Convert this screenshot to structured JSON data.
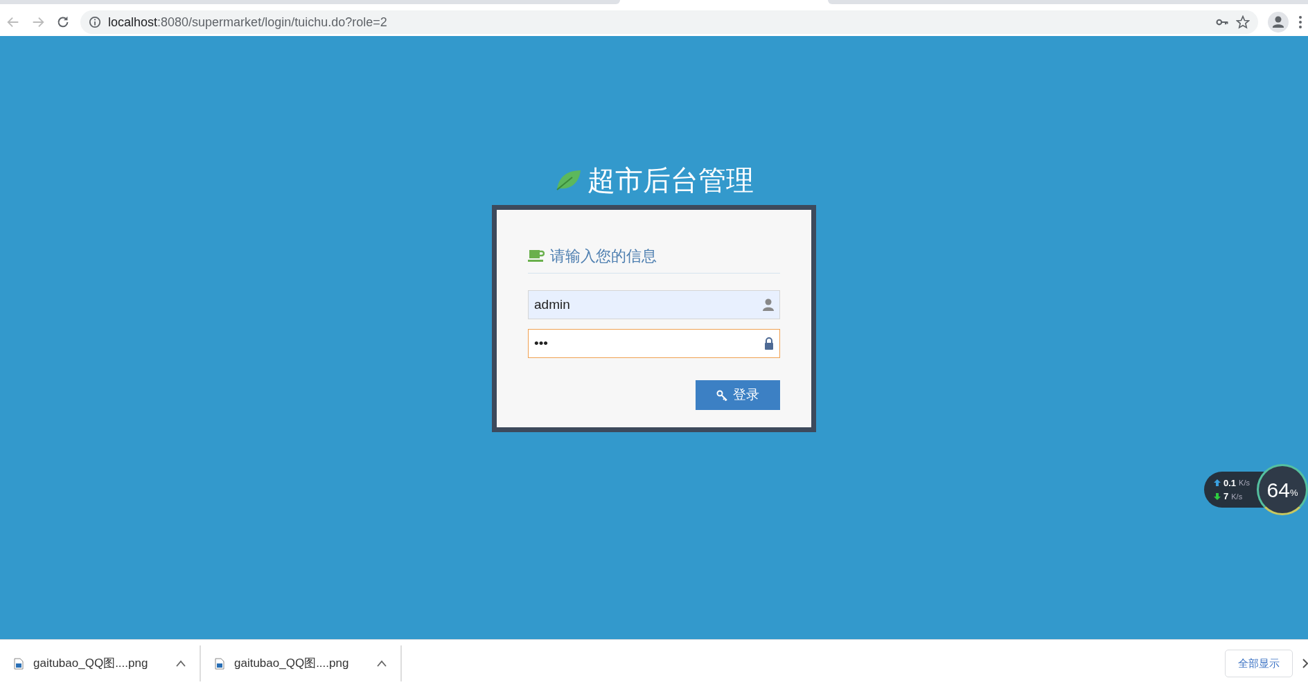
{
  "browser": {
    "address": {
      "host": "localhost",
      "rest": ":8080/supermarket/login/tuichu.do?role=2"
    }
  },
  "login": {
    "title": "超市后台管理",
    "heading": "请输入您的信息",
    "fields": [
      {
        "kind": "text",
        "value": "admin",
        "autofilled": true,
        "focused": false
      },
      {
        "kind": "password",
        "value": "•••",
        "autofilled": false,
        "focused": true
      }
    ],
    "submit": "登录"
  },
  "net_monitor": {
    "upload": "0.1",
    "download": "7",
    "unit_up": "K/s",
    "unit_down": "K/s",
    "percent": "64",
    "percent_sign": "%"
  },
  "downloads": {
    "items": [
      {
        "name": "gaitubao_QQ图....png"
      },
      {
        "name": "gaitubao_QQ图....png"
      }
    ],
    "show_all": "全部显示"
  }
}
